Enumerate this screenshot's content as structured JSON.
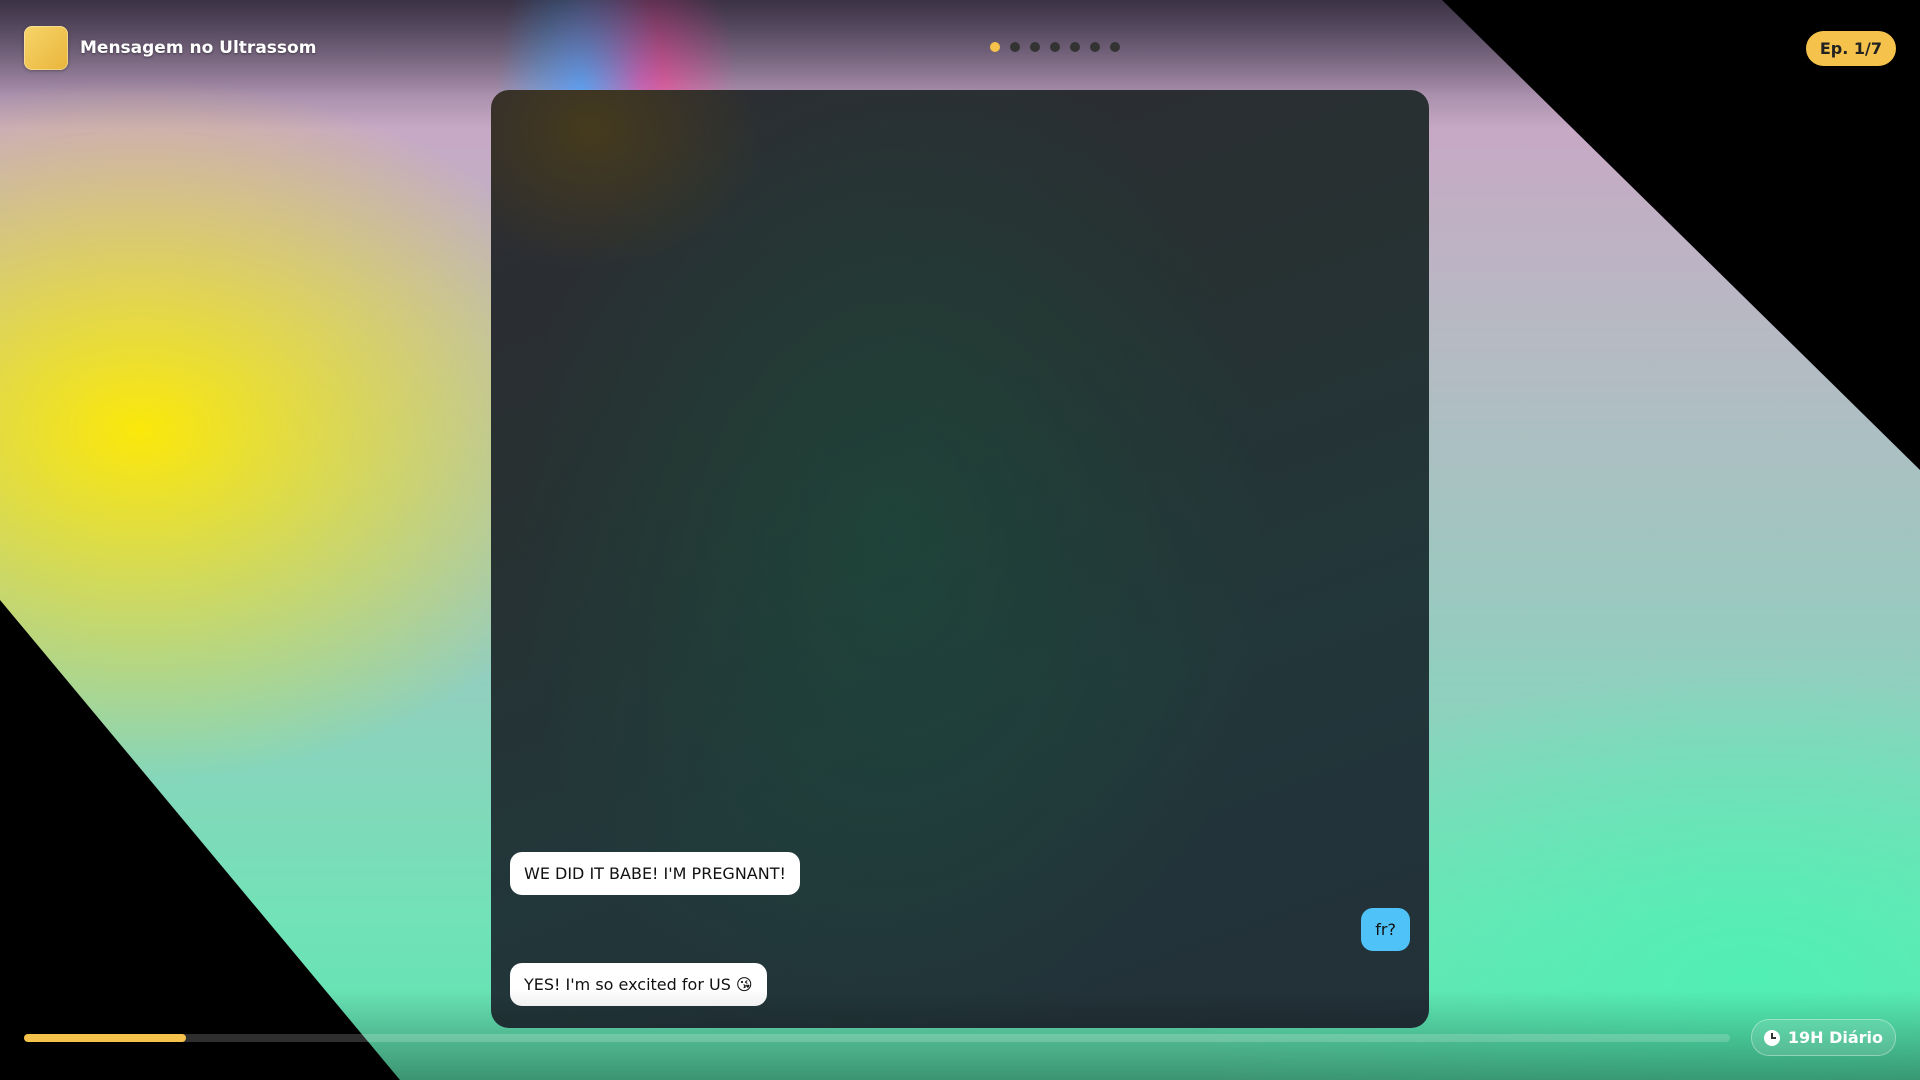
{
  "header": {
    "title": "Mensagem no Ultrassom",
    "episode_badge": "Ep. 1/7",
    "episode_dots": {
      "total": 7,
      "active_index": 0
    },
    "colors": {
      "accent": "#f5c24b"
    }
  },
  "chat": {
    "messages": [
      {
        "direction": "incoming",
        "text": "WE DID IT BABE! I'M PREGNANT!"
      },
      {
        "direction": "outgoing",
        "text": "fr?"
      },
      {
        "direction": "incoming",
        "text": "YES! I'm so excited for US 😘"
      }
    ],
    "colors": {
      "incoming_bubble": "#ffffff",
      "outgoing_bubble": "#4fc3f7"
    }
  },
  "footer": {
    "progress_fraction": 0.095,
    "timer_label": "19H Diário",
    "timer_icon": "clock-icon"
  }
}
